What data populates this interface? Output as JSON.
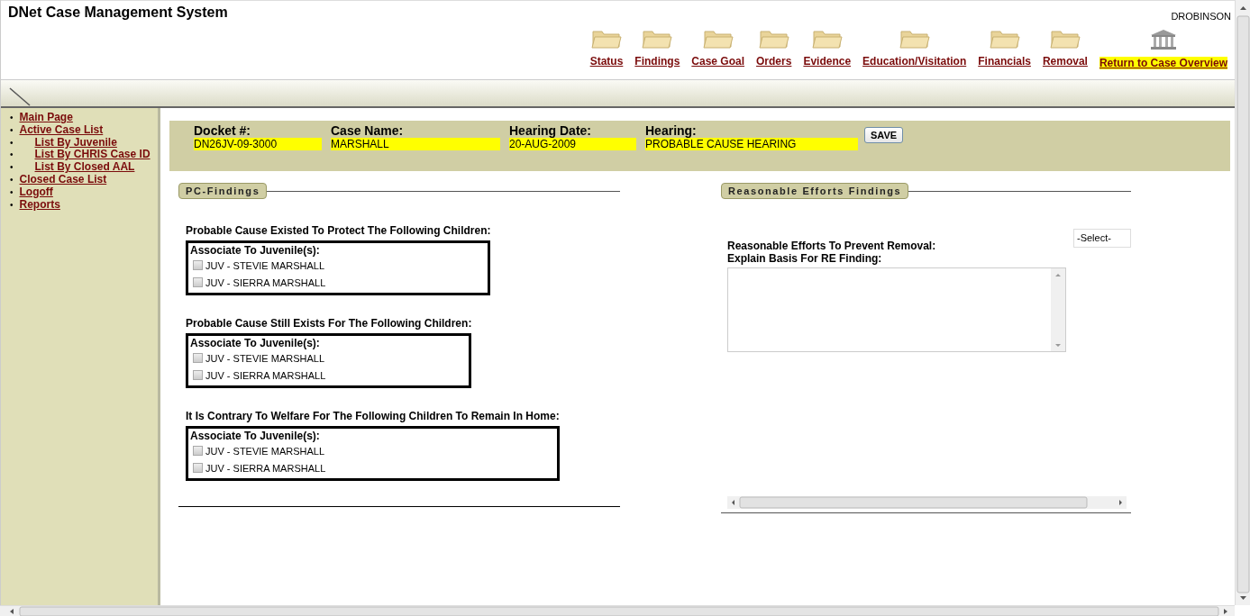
{
  "window": {
    "title": "DNet Case Management System",
    "user": "DROBINSON"
  },
  "nav": [
    {
      "label": "Status",
      "kind": "folder",
      "highlighted": false
    },
    {
      "label": "Findings",
      "kind": "folder",
      "highlighted": false
    },
    {
      "label": "Case Goal",
      "kind": "folder",
      "highlighted": false
    },
    {
      "label": "Orders",
      "kind": "folder",
      "highlighted": false
    },
    {
      "label": "Evidence",
      "kind": "folder",
      "highlighted": false
    },
    {
      "label": "Education/Visitation",
      "kind": "folder",
      "highlighted": false
    },
    {
      "label": "Financials",
      "kind": "folder",
      "highlighted": false
    },
    {
      "label": "Removal",
      "kind": "folder",
      "highlighted": false
    },
    {
      "label": "Return to Case Overview",
      "kind": "building",
      "highlighted": true
    }
  ],
  "sidebar": {
    "items": [
      {
        "bullet": "•",
        "label": "Main Page"
      },
      {
        "bullet": "•",
        "label": "Active Case List",
        "children": [
          {
            "bullet": "•",
            "label": "List By Juvenile"
          },
          {
            "bullet": "•",
            "label": "List By CHRIS Case ID"
          },
          {
            "bullet": "•",
            "label": "List By Closed AAL"
          }
        ]
      },
      {
        "bullet": "•",
        "label": "Closed Case List"
      },
      {
        "bullet": "•",
        "label": "Logoff"
      },
      {
        "bullet": "•",
        "label": "Reports"
      }
    ]
  },
  "case_header": {
    "fields": [
      {
        "label": "Docket #:",
        "value": "DN26JV-09-3000"
      },
      {
        "label": "Case Name:",
        "value": "MARSHALL"
      },
      {
        "label": "Hearing Date:",
        "value": "20-AUG-2009"
      },
      {
        "label": "Hearing:",
        "value": "PROBABLE CAUSE HEARING"
      }
    ],
    "save_button": "SAVE"
  },
  "pc_findings": {
    "title": "PC-Findings",
    "groups": [
      {
        "question": "Probable Cause Existed To Protect The Following Children:",
        "box_label": "Associate To Juvenile(s):",
        "juveniles": [
          {
            "name": "JUV - STEVIE MARSHALL",
            "checked": false
          },
          {
            "name": "JUV - SIERRA MARSHALL",
            "checked": false
          }
        ]
      },
      {
        "question": "Probable Cause Still Exists For The Following Children:",
        "box_label": "Associate To Juvenile(s):",
        "juveniles": [
          {
            "name": "JUV - STEVIE MARSHALL",
            "checked": false
          },
          {
            "name": "JUV - SIERRA MARSHALL",
            "checked": false
          }
        ]
      },
      {
        "question": "It Is Contrary To Welfare For The Following Children To Remain In Home:",
        "box_label": "Associate To Juvenile(s):",
        "juveniles": [
          {
            "name": "JUV - STEVIE MARSHALL",
            "checked": false
          },
          {
            "name": "JUV - SIERRA MARSHALL",
            "checked": false
          }
        ]
      }
    ]
  },
  "re_findings": {
    "title": "Reasonable Efforts Findings",
    "prevent_removal_label": "Reasonable Efforts To Prevent Removal:",
    "prevent_removal_select": "-Select-",
    "basis_label": "Explain Basis For RE Finding:"
  }
}
